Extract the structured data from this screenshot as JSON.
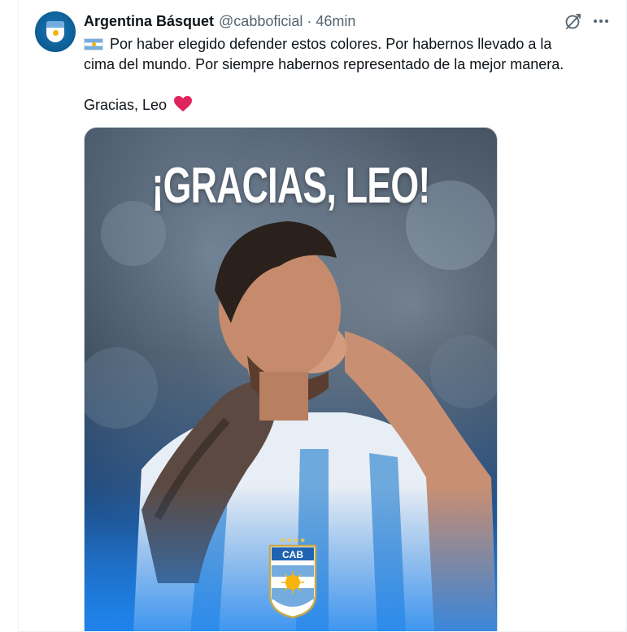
{
  "tweet": {
    "author_name": "Argentina Básquet",
    "handle": "@cabboficial",
    "separator": "·",
    "time": "46min",
    "text_line1": "Por haber elegido defender estos colores. Por habernos llevado a la",
    "text_line2": "cima del mundo. Por siempre habernos representado de la mejor manera.",
    "text_para2": "Gracias, Leo",
    "flag_icon": "argentina-flag-icon",
    "heart_icon": "red-heart-icon"
  },
  "media": {
    "headline": "¡GRACIAS, LEO!",
    "logo_text": "CAB"
  },
  "colors": {
    "accent_blue": "#74acdf",
    "sun_gold": "#f6b40e",
    "heart_red": "#e0245e",
    "secondary_text": "#536471"
  }
}
